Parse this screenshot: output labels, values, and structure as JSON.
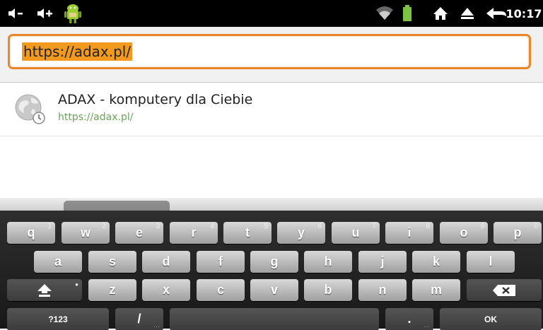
{
  "status_bar": {
    "time": "10:17",
    "icons": [
      "volume-down-icon",
      "volume-up-icon",
      "android-icon",
      "wifi-icon",
      "battery-icon",
      "home-icon",
      "eject-icon",
      "back-icon"
    ]
  },
  "address_bar": {
    "url": "https://adax.pl/"
  },
  "suggestion": {
    "title": "ADAX - komputery dla Ciebie",
    "url": "https://adax.pl/"
  },
  "keyboard": {
    "row1": [
      {
        "label": "q",
        "hint": "1"
      },
      {
        "label": "w",
        "hint": "2"
      },
      {
        "label": "e",
        "hint": "3"
      },
      {
        "label": "r",
        "hint": "4"
      },
      {
        "label": "t",
        "hint": "5"
      },
      {
        "label": "y",
        "hint": "6"
      },
      {
        "label": "u",
        "hint": "7"
      },
      {
        "label": "i",
        "hint": "8"
      },
      {
        "label": "o",
        "hint": "9"
      },
      {
        "label": "p",
        "hint": "0"
      }
    ],
    "row2": [
      "a",
      "s",
      "d",
      "f",
      "g",
      "h",
      "j",
      "k",
      "l"
    ],
    "row3": [
      "z",
      "x",
      "c",
      "v",
      "b",
      "n",
      "m"
    ],
    "symbols_label": "?123",
    "slash_label": "/",
    "dot_label": ".",
    "ok_label": "OK"
  },
  "colors": {
    "accent": "#e8862a",
    "selection": "#f29a1f",
    "url_green": "#6aa35a"
  }
}
